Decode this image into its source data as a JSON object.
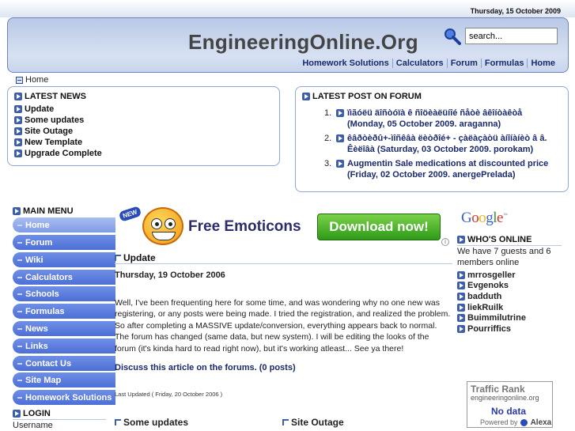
{
  "date": "Thursday, 15 October 2009",
  "header": {
    "title": "EngineeringOnline.Org",
    "search_value": "search...",
    "nav": [
      "Homework Solutions",
      "Calculators",
      "Forum",
      "Formulas",
      "Home"
    ]
  },
  "breadcrumb": "Home",
  "latest_news": {
    "heading": "LATEST NEWS",
    "items": [
      "Update",
      "Some updates",
      "Site Outage",
      "New Template",
      "Upgrade Complete"
    ]
  },
  "latest_forum": {
    "heading": "LATEST POST ON FORUM",
    "posts": [
      {
        "num": "1.",
        "text": "ïìãóëü äîñòóïà ê ñîöèàëüíîé ñåòè âêîíòàêòå (Monday, 05 October 2009. araganna)"
      },
      {
        "num": "2.",
        "text": "êâðòèðû+-ìîñêâà ëèòðîé+ - çàëàçàòü àíîíàíèò â â. Êèëîâà (Saturday, 03 October 2009. porokam)"
      },
      {
        "num": "3.",
        "text": "Augmentin Sale medications at discounted price (Friday, 02 October 2009. anergePrelada)"
      }
    ]
  },
  "main_menu": {
    "heading": "MAIN MENU",
    "items": [
      "Home",
      "Forum",
      "Wiki",
      "Calculators",
      "Schools",
      "Formulas",
      "News",
      "Links",
      "Contact Us",
      "Site Map",
      "Homework Solutions"
    ]
  },
  "login": {
    "heading": "LOGIN",
    "username_label": "Username"
  },
  "banner": {
    "badge": "NEW",
    "title": "Free Emoticons",
    "button": "Download now!",
    "info": "i"
  },
  "article": {
    "title": "Update",
    "date": "Thursday, 19 October 2006",
    "body": "Well, I've been frequenting here for some time, and was wondering why no one new was registering, or any posts were being made. I tried the registration, and realized the problem. So after completing a MASSIVE update/conversion, everything appears back to normal. The forum has changed (same data, but new system). I will be editing the looks of the forum (it's kinda hard to read right now), but it's working atleast... See ya there!",
    "link": "Discuss this article on the forums. (0 posts)",
    "last_updated": "Last Updated ( Friday, 20 October 2006 )"
  },
  "more_articles": [
    "Some updates",
    "Site Outage"
  ],
  "google": {
    "letters": [
      "G",
      "o",
      "o",
      "g",
      "l",
      "e"
    ],
    "colors": [
      "#3b62c9",
      "#d9352a",
      "#f0b21c",
      "#3b62c9",
      "#2e9b3b",
      "#d9352a"
    ],
    "tm": "™"
  },
  "whos_online": {
    "heading": "WHO'S ONLINE",
    "summary": "We have 7 guests and 6 members online",
    "members": [
      "mrrosgeller",
      "Evgenoks",
      "badduth",
      "liekRuilk",
      "Buimmilutrine",
      "Pourriffics"
    ]
  },
  "alexa": {
    "title": "Traffic Rank",
    "site": "engineeringonline.org",
    "value": "No data",
    "powered": "Powered by",
    "brand": "Alexa"
  }
}
